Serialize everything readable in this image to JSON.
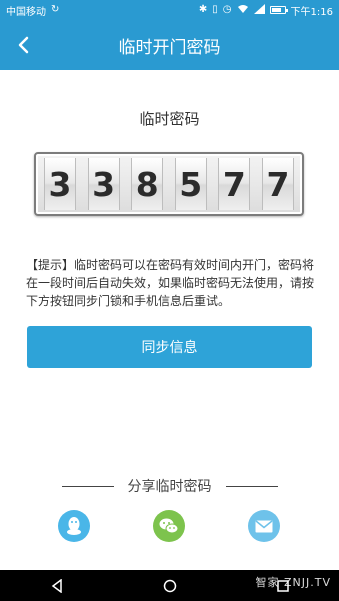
{
  "status_bar": {
    "carrier": "中国移动",
    "time": "下午1:16",
    "battery_level": 0.75
  },
  "header": {
    "title": "临时开门密码",
    "back_icon": "chevron-left-icon"
  },
  "code": {
    "label": "临时密码",
    "digits": [
      "3",
      "3",
      "8",
      "5",
      "7",
      "7"
    ]
  },
  "hint": {
    "text": "【提示】临时密码可以在密码有效时间内开门，密码将在一段时间后自动失效，如果临时密码无法使用，请按下方按钮同步门锁和手机信息后重试。"
  },
  "sync_button": {
    "label": "同步信息"
  },
  "share": {
    "title": "分享临时密码",
    "targets": [
      {
        "icon": "qq-icon"
      },
      {
        "icon": "wechat-icon"
      },
      {
        "icon": "mail-icon"
      }
    ]
  },
  "watermark": "智家 ZNJJ.TV",
  "colors": {
    "primary": "#2a9ad1",
    "button": "#2ea3d8",
    "qq": "#4ab6e8",
    "wechat": "#7dc34d",
    "mail": "#6ec2ea"
  }
}
